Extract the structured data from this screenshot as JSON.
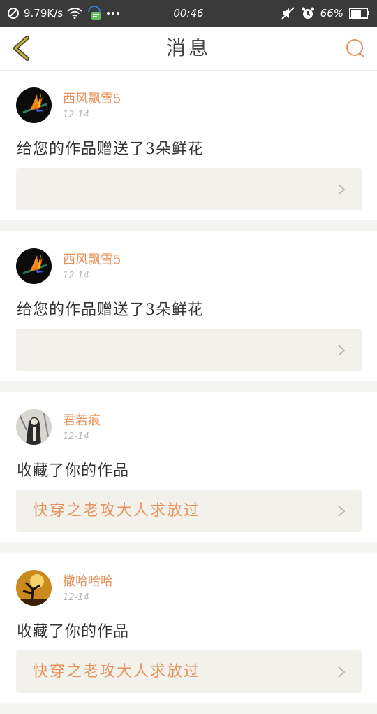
{
  "status_bar": {
    "net_speed": "9.79K/s",
    "time": "00:46",
    "battery": "66%",
    "icons": [
      "block-icon",
      "wifi-icon",
      "chat-notification-icon",
      "more-dots-icon",
      "mute-icon",
      "alarm-icon",
      "battery-icon"
    ]
  },
  "header": {
    "title": "消息",
    "back_icon": "chevron-left-icon",
    "search_icon": "search-icon",
    "accent_color": "#e8925a",
    "back_color": "#c9b030"
  },
  "messages": [
    {
      "username": "西风飘雪5",
      "date": "12-14",
      "text": "给您的作品赠送了3朵鲜花",
      "work_title": "",
      "avatar": "flower-avatar"
    },
    {
      "username": "西风飘雪5",
      "date": "12-14",
      "text": "给您的作品赠送了3朵鲜花",
      "work_title": "",
      "avatar": "flower-avatar"
    },
    {
      "username": "君若痕",
      "date": "12-14",
      "text": "收藏了你的作品",
      "work_title": "快穿之老攻大人求放过",
      "avatar": "portrait-avatar"
    },
    {
      "username": "撒哈哈哈",
      "date": "12-14",
      "text": "收藏了你的作品",
      "work_title": "快穿之老攻大人求放过",
      "avatar": "tree-avatar"
    }
  ]
}
